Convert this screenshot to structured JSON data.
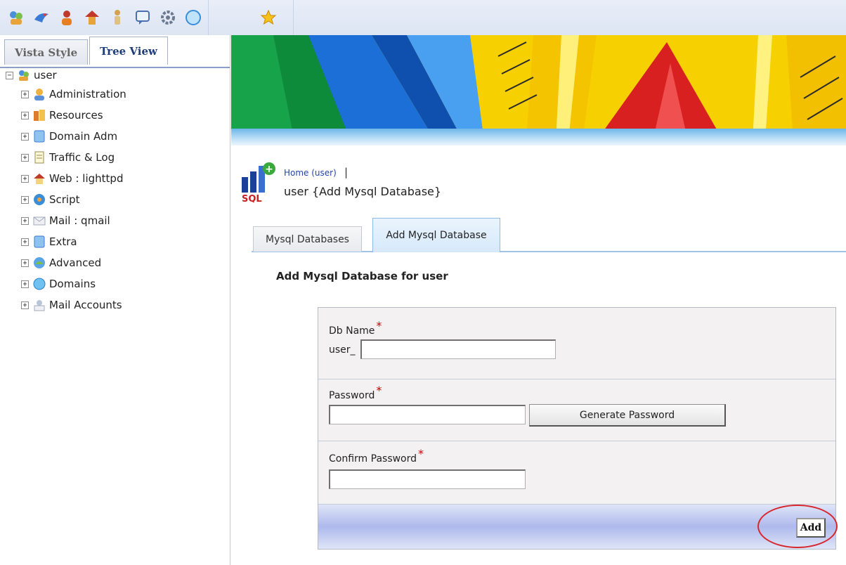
{
  "toolbar": {
    "icons": [
      "user-group-icon",
      "bird-icon",
      "user-red-icon",
      "user-home-icon",
      "person-icon",
      "message-icon",
      "gear-icon",
      "globe-icon",
      "star-icon"
    ]
  },
  "left_panel": {
    "tabs": [
      {
        "label": "Vista Style",
        "active": false
      },
      {
        "label": "Tree View",
        "active": true
      }
    ],
    "tree": {
      "root_label": "user",
      "items": [
        {
          "label": "Administration",
          "icon": "admin-icon"
        },
        {
          "label": "Resources",
          "icon": "resources-icon"
        },
        {
          "label": "Domain Adm",
          "icon": "domain-adm-icon"
        },
        {
          "label": "Traffic & Log",
          "icon": "traffic-log-icon"
        },
        {
          "label": "Web : lighttpd",
          "icon": "web-home-icon"
        },
        {
          "label": "Script",
          "icon": "script-icon"
        },
        {
          "label": "Mail : qmail",
          "icon": "mail-icon"
        },
        {
          "label": "Extra",
          "icon": "extra-icon"
        },
        {
          "label": "Advanced",
          "icon": "advanced-icon"
        },
        {
          "label": "Domains",
          "icon": "domains-icon"
        },
        {
          "label": "Mail Accounts",
          "icon": "mail-accounts-icon"
        }
      ]
    }
  },
  "breadcrumb": {
    "home_link": "Home (user)",
    "separator": "|",
    "subtitle": "user {Add Mysql Database}"
  },
  "content_tabs": [
    {
      "label": "Mysql Databases",
      "active": false
    },
    {
      "label": "Add Mysql Database",
      "active": true
    }
  ],
  "form": {
    "heading": "Add Mysql Database for user",
    "db_name": {
      "label": "Db Name",
      "required_mark": "*",
      "prefix": "user_",
      "value": ""
    },
    "password": {
      "label": "Password",
      "required_mark": "*",
      "value": ""
    },
    "generate_button": "Generate Password",
    "confirm_password": {
      "label": "Confirm Password",
      "required_mark": "*",
      "value": ""
    },
    "submit_button": "Add"
  },
  "colors": {
    "required": "#cc0000",
    "highlight_circle": "#d8262d",
    "link": "#2244aa"
  }
}
